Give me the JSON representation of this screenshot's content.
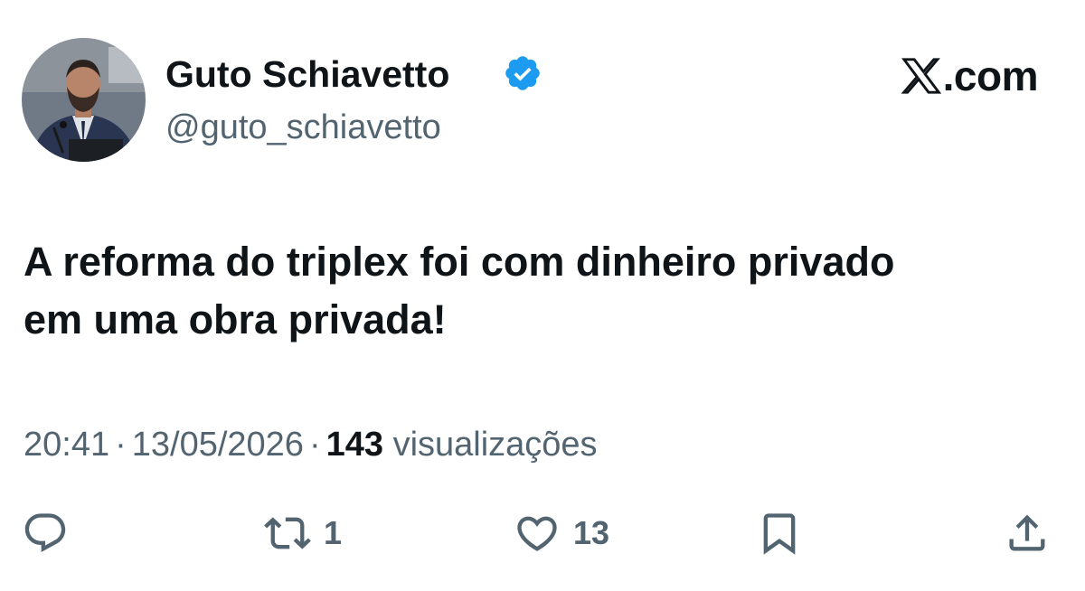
{
  "author": {
    "display_name": "Guto Schiavetto",
    "handle": "@guto_schiavetto",
    "verified": true,
    "avatar_icon": "person-photo"
  },
  "source": {
    "logo_icon": "x-logo-icon",
    "domain": ".com"
  },
  "tweet": {
    "line1": "A reforma do triplex foi com dinheiro privado",
    "line2": "em uma obra privada!"
  },
  "meta": {
    "time": "20:41",
    "separator": "·",
    "date": "13/05/2026",
    "views_count": "143",
    "views_label": "visualizações"
  },
  "actions": {
    "reply_icon": "reply-icon",
    "retweet_icon": "retweet-icon",
    "retweet_count": "1",
    "like_icon": "heart-icon",
    "like_count": "13",
    "bookmark_icon": "bookmark-icon",
    "share_icon": "share-icon"
  },
  "colors": {
    "text_primary": "#0f1419",
    "text_secondary": "#536471",
    "verified_blue": "#1d9bf0"
  }
}
